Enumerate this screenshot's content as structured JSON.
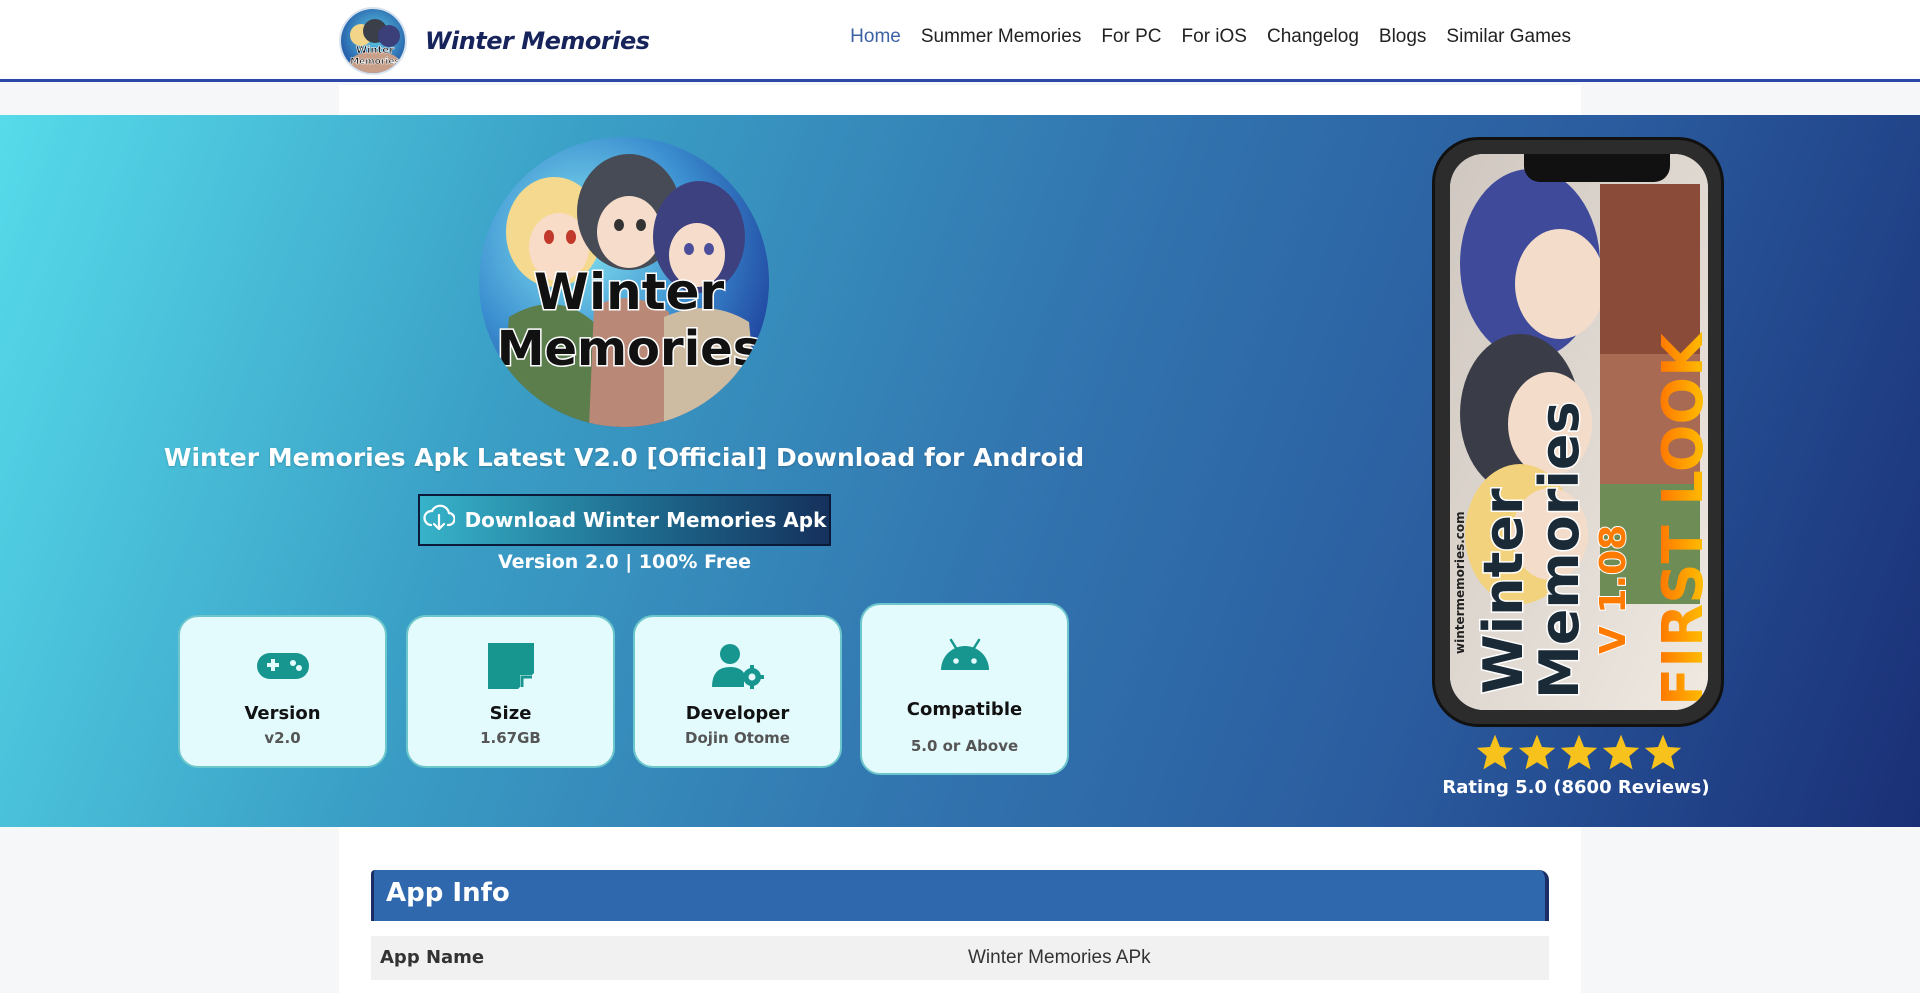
{
  "header": {
    "site_title": "Winter Memories",
    "logo_alt": "Winter Memories",
    "nav": [
      {
        "label": "Home",
        "active": true
      },
      {
        "label": "Summer Memories",
        "active": false
      },
      {
        "label": "For PC",
        "active": false
      },
      {
        "label": "For iOS",
        "active": false
      },
      {
        "label": "Changelog",
        "active": false
      },
      {
        "label": "Blogs",
        "active": false
      },
      {
        "label": "Similar Games",
        "active": false
      }
    ]
  },
  "hero": {
    "logo_text_line1": "Winter",
    "logo_text_line2": "Memories",
    "title": "Winter Memories Apk Latest V2.0 [Official] Download for Android",
    "download_button": "Download Winter Memories Apk",
    "subline": "Version 2.0 | 100% Free",
    "cards": [
      {
        "title": "Version",
        "value": "v2.0",
        "icon": "gamepad-icon"
      },
      {
        "title": "Size",
        "value": "1.67GB",
        "icon": "file-icon"
      },
      {
        "title": "Developer",
        "value": "Dojin Otome",
        "icon": "user-gear-icon"
      },
      {
        "title": "Compatible",
        "value": "5.0 or Above",
        "icon": "android-icon"
      }
    ],
    "phone_screen": {
      "site": "wintermemories.com",
      "title_line1": "Winter",
      "title_line2": "Memories",
      "version": "V 1.08",
      "tag": "FIRST LOOK"
    },
    "rating": {
      "stars": 5,
      "text": "Rating 5.0 (8600 Reviews)"
    }
  },
  "app_info": {
    "heading": "App Info",
    "rows": [
      {
        "key": "App Name",
        "value": "Winter Memories APk"
      }
    ]
  },
  "colors": {
    "brand_dark": "#17245c",
    "nav_active": "#3d62a4",
    "card_bg": "#e3fbfd",
    "teal_icon": "#17968f",
    "star": "#f8c21c",
    "info_header": "#2f68ad"
  }
}
